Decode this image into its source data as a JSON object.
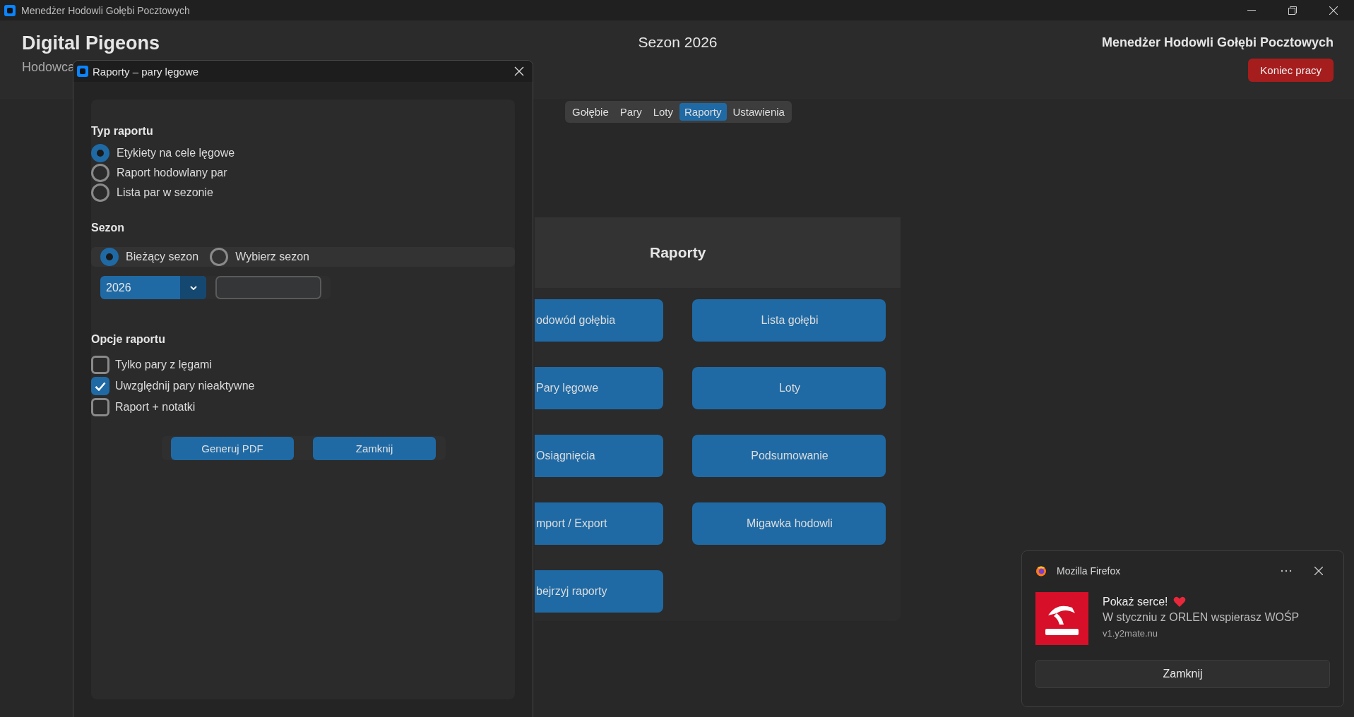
{
  "app_window": {
    "title": "Menedżer Hodowli Gołębi Pocztowych"
  },
  "header": {
    "app_name": "Digital Pigeons",
    "subtitle": "Hodowca",
    "season": "Sezon 2026",
    "title": "Menedżer Hodowli Gołębi Pocztowych",
    "logout_button": "Koniec pracy"
  },
  "tabs": [
    {
      "label": "Gołębie",
      "selected": false
    },
    {
      "label": "Pary",
      "selected": false
    },
    {
      "label": "Loty",
      "selected": false
    },
    {
      "label": "Raporty",
      "selected": true
    },
    {
      "label": "Ustawienia",
      "selected": false
    }
  ],
  "reports_panel": {
    "title": "Raporty",
    "buttons": [
      "odowód gołębia",
      "Lista gołębi",
      "Pary lęgowe",
      "Loty",
      "Osiągnięcia",
      "Podsumowanie",
      "mport / Export",
      "Migawka hodowli",
      "bejrzyj raporty"
    ]
  },
  "dialog": {
    "title": "Raporty – pary lęgowe",
    "report_type": {
      "heading": "Typ raportu",
      "options": [
        {
          "label": "Etykiety na cele lęgowe",
          "selected": true
        },
        {
          "label": "Raport hodowlany par",
          "selected": false
        },
        {
          "label": "Lista par w sezonie",
          "selected": false
        }
      ]
    },
    "season": {
      "heading": "Sezon",
      "options": [
        {
          "label": "Bieżący sezon",
          "selected": true
        },
        {
          "label": "Wybierz sezon",
          "selected": false
        }
      ],
      "year": "2026"
    },
    "report_options": {
      "heading": "Opcje raportu",
      "items": [
        {
          "label": "Tylko pary z lęgami",
          "checked": false
        },
        {
          "label": "Uwzględnij pary nieaktywne",
          "checked": true
        },
        {
          "label": "Raport + notatki",
          "checked": false
        }
      ]
    },
    "buttons": [
      "Generuj PDF",
      "Zamknij"
    ]
  },
  "notification": {
    "app": "Mozilla Firefox",
    "title": "Pokaż serce!",
    "body": "W styczniu z ORLEN wspierasz WOŚP",
    "source": "v1.y2mate.nu",
    "button": "Zamknij"
  }
}
